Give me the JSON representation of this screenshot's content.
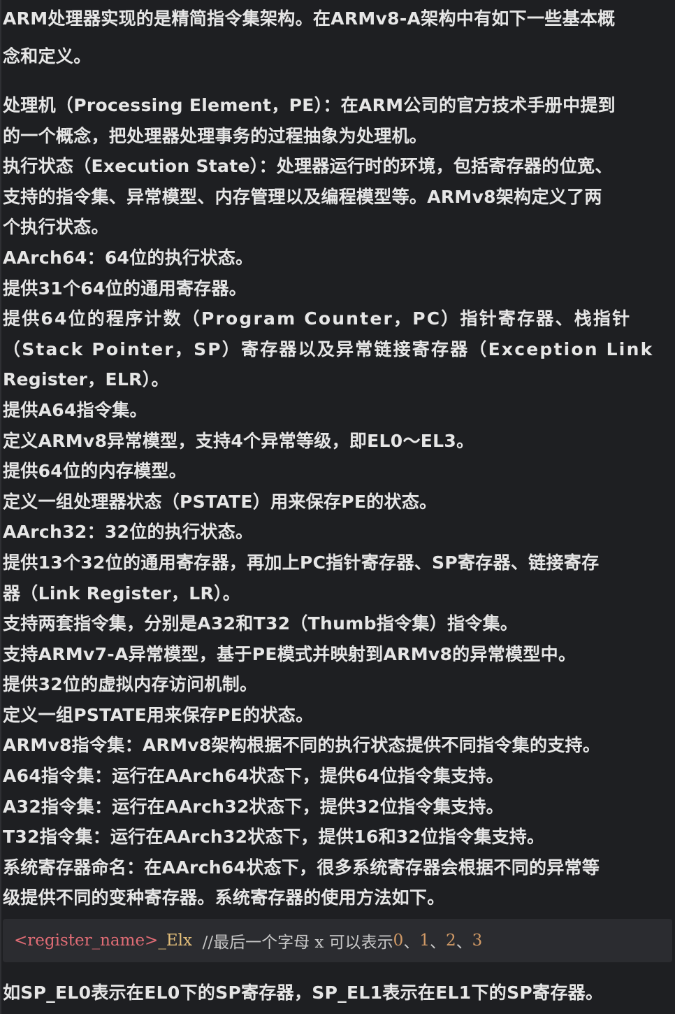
{
  "intro": {
    "line1": "ARM处理器实现的是精简指令集架构。在ARMv8-A架构中有如下一些基本概",
    "line2": "念和定义。"
  },
  "lines": [
    "处理机（Processing Element，PE）：在ARM公司的官方技术手册中提到",
    "的一个概念，把处理器处理事务的过程抽象为处理机。",
    "执行状态（Execution State）：处理器运行时的环境，包括寄存器的位宽、",
    "支持的指令集、异常模型、内存管理以及编程模型等。ARMv8架构定义了两",
    "个执行状态。",
    "AArch64：64位的执行状态。",
    "提供31个64位的通用寄存器。",
    "提供64位的程序计数（Program Counter，PC）指针寄存器、栈指针",
    "（Stack Pointer，SP）寄存器以及异常链接寄存器（Exception Link",
    "Register，ELR）。",
    "提供A64指令集。",
    "定义ARMv8异常模型，支持4个异常等级，即EL0～EL3。",
    "提供64位的内存模型。",
    "定义一组处理器状态（PSTATE）用来保存PE的状态。",
    "AArch32：32位的执行状态。",
    "提供13个32位的通用寄存器，再加上PC指针寄存器、SP寄存器、链接寄存",
    "器（Link Register，LR）。",
    "支持两套指令集，分别是A32和T32（Thumb指令集）指令集。",
    "支持ARMv7-A异常模型，基于PE模式并映射到ARMv8的异常模型中。",
    "提供32位的虚拟内存访问机制。",
    "定义一组PSTATE用来保存PE的状态。",
    "ARMv8指令集：ARMv8架构根据不同的执行状态提供不同指令集的支持。",
    "A64指令集：运行在AArch64状态下，提供64位指令集支持。",
    "A32指令集：运行在AArch32状态下，提供32位指令集支持。",
    "T32指令集：运行在AArch32状态下，提供16和32位指令集支持。",
    "系统寄存器命名：在AArch64状态下，很多系统寄存器会根据不同的异常等",
    "级提供不同的变种寄存器。系统寄存器的使用方法如下。"
  ],
  "code": {
    "tag": "<register_name>",
    "suffix": "_Elx",
    "comment_prefix": "  //最后一个字母 x 可以表示",
    "n0": "0",
    "sep1": "、",
    "n1": "1",
    "sep2": "、",
    "n2": "2",
    "sep3": "、",
    "n3": "3"
  },
  "footer": "如SP_EL0表示在EL0下的SP寄存器，SP_EL1表示在EL1下的SP寄存器。"
}
